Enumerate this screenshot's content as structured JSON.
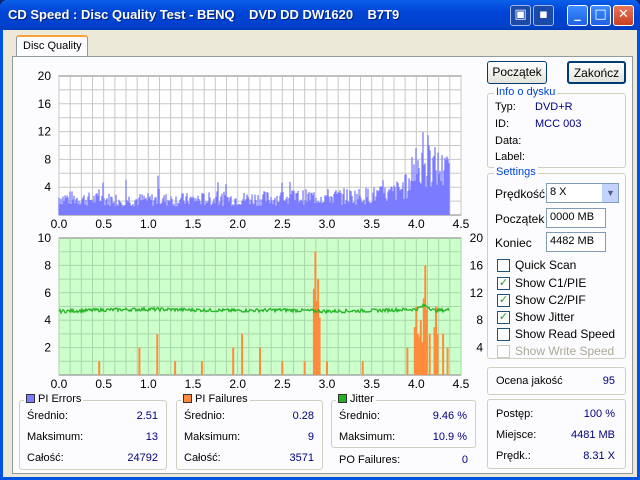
{
  "window": {
    "title": "CD Speed : Disc Quality Test - BENQ    DVD DD DW1620    B7T9"
  },
  "tab": {
    "label": "Disc Quality"
  },
  "buttons": {
    "start": "Początek",
    "end": "Zakończ"
  },
  "disc_info": {
    "title": "Info o dysku",
    "type_label": "Typ:",
    "type_value": "DVD+R",
    "id_label": "ID:",
    "id_value": "MCC 003",
    "date_label": "Data:",
    "date_value": "",
    "label_label": "Label:",
    "label_value": ""
  },
  "settings": {
    "title": "Settings",
    "speed_label": "Prędkość",
    "speed_value": "8 X",
    "start_label": "Początek",
    "start_value": "0000 MB",
    "end_label": "Koniec",
    "end_value": "4482 MB",
    "checkboxes": [
      {
        "label": "Quick Scan",
        "checked": false,
        "enabled": true
      },
      {
        "label": "Show C1/PIE",
        "checked": true,
        "enabled": true
      },
      {
        "label": "Show C2/PIF",
        "checked": true,
        "enabled": true
      },
      {
        "label": "Show Jitter",
        "checked": true,
        "enabled": true
      },
      {
        "label": "Show Read Speed",
        "checked": false,
        "enabled": true
      },
      {
        "label": "Show Write Speed",
        "checked": false,
        "enabled": false
      }
    ]
  },
  "quality": {
    "label": "Ocena jakość",
    "value": "95"
  },
  "progress": {
    "progress_label": "Postęp:",
    "progress_value": "100 %",
    "position_label": "Miejsce:",
    "position_value": "4481 MB",
    "speed_label": "Prędk.:",
    "speed_value": "8.31 X"
  },
  "pi_errors": {
    "title": "PI Errors",
    "color": "#7b7bff",
    "avg_label": "Średnio:",
    "avg": "2.51",
    "max_label": "Maksimum:",
    "max": "13",
    "total_label": "Całość:",
    "total": "24792"
  },
  "pi_failures": {
    "title": "PI Failures",
    "color": "#ff8c3c",
    "avg_label": "Średnio:",
    "avg": "0.28",
    "max_label": "Maksimum:",
    "max": "9",
    "total_label": "Całość:",
    "total": "3571"
  },
  "jitter": {
    "title": "Jitter",
    "color": "#22b322",
    "avg_label": "Średnio:",
    "avg": "9.46 %",
    "max_label": "Maksimum:",
    "max": "10.9 %"
  },
  "po_failures": {
    "label": "PO Failures:",
    "value": "0"
  },
  "chart_data": [
    {
      "type": "bar",
      "series": [
        {
          "name": "PI Errors",
          "color": "#7b7bff"
        }
      ],
      "xlim": [
        0,
        4.5
      ],
      "ylim": [
        0,
        20
      ],
      "x_ticks": [
        "0.0",
        "0.5",
        "1.0",
        "1.5",
        "2.0",
        "2.5",
        "3.0",
        "3.5",
        "4.0",
        "4.5"
      ],
      "y_ticks": [
        "20",
        "16",
        "12",
        "8",
        "4"
      ],
      "grid": true,
      "profile": [
        [
          0.0,
          2.5
        ],
        [
          0.3,
          2.3
        ],
        [
          0.8,
          2.2
        ],
        [
          1.3,
          2.2
        ],
        [
          1.8,
          2.3
        ],
        [
          2.3,
          2.4
        ],
        [
          2.8,
          2.6
        ],
        [
          3.3,
          2.7
        ],
        [
          3.7,
          3.0
        ],
        [
          3.95,
          4.5
        ],
        [
          4.05,
          7.5
        ],
        [
          4.2,
          7.0
        ],
        [
          4.35,
          6.0
        ]
      ],
      "max": 13
    },
    {
      "type": "bar",
      "series": [
        {
          "name": "PI Failures",
          "color": "#ff8c3c"
        },
        {
          "name": "Jitter",
          "color": "#22b322"
        }
      ],
      "xlim": [
        0,
        4.5
      ],
      "ylim_left": [
        0,
        10
      ],
      "ylim_right": [
        4,
        20
      ],
      "x_ticks": [
        "0.0",
        "0.5",
        "1.0",
        "1.5",
        "2.0",
        "2.5",
        "3.0",
        "3.5",
        "4.0",
        "4.5"
      ],
      "y_ticks_left": [
        "10",
        "8",
        "6",
        "4",
        "2"
      ],
      "y_ticks_right": [
        "20",
        "16",
        "12",
        "8",
        "4"
      ],
      "grid": true,
      "pif_spikes": [
        [
          0.45,
          1
        ],
        [
          0.9,
          2
        ],
        [
          1.1,
          3
        ],
        [
          1.3,
          1
        ],
        [
          1.6,
          1
        ],
        [
          1.95,
          2
        ],
        [
          2.05,
          3
        ],
        [
          2.25,
          2
        ],
        [
          2.5,
          1
        ],
        [
          2.75,
          1
        ],
        [
          2.87,
          9
        ],
        [
          2.9,
          7
        ],
        [
          3.0,
          1
        ],
        [
          3.4,
          1
        ],
        [
          3.9,
          2
        ],
        [
          4.0,
          5
        ],
        [
          4.05,
          4
        ],
        [
          4.1,
          8
        ],
        [
          4.15,
          3
        ],
        [
          4.22,
          5
        ],
        [
          4.3,
          3
        ],
        [
          4.35,
          2
        ]
      ],
      "jitter": [
        [
          0.0,
          9.3
        ],
        [
          0.5,
          9.5
        ],
        [
          1.0,
          9.6
        ],
        [
          1.5,
          9.5
        ],
        [
          2.0,
          9.4
        ],
        [
          2.5,
          9.5
        ],
        [
          3.0,
          9.3
        ],
        [
          3.5,
          9.4
        ],
        [
          4.0,
          9.6
        ],
        [
          4.1,
          10.2
        ],
        [
          4.2,
          9.4
        ],
        [
          4.35,
          9.5
        ]
      ]
    }
  ]
}
